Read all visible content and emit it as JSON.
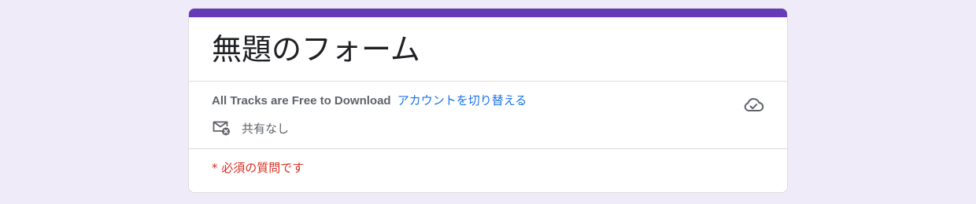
{
  "colors": {
    "page_background": "#f0ebf8",
    "accent": "#673ab7",
    "link": "#1a73e8",
    "required": "#d93025",
    "muted_text": "#5f6368"
  },
  "form": {
    "title": "無題のフォーム"
  },
  "account": {
    "name": "All Tracks are Free to Download",
    "switch_label": "アカウントを切り替える",
    "sync_icon": "cloud-done-icon"
  },
  "sharing": {
    "icon": "mail-off-icon",
    "label": "共有なし"
  },
  "required_notice": {
    "text": "* 必須の質問です"
  }
}
